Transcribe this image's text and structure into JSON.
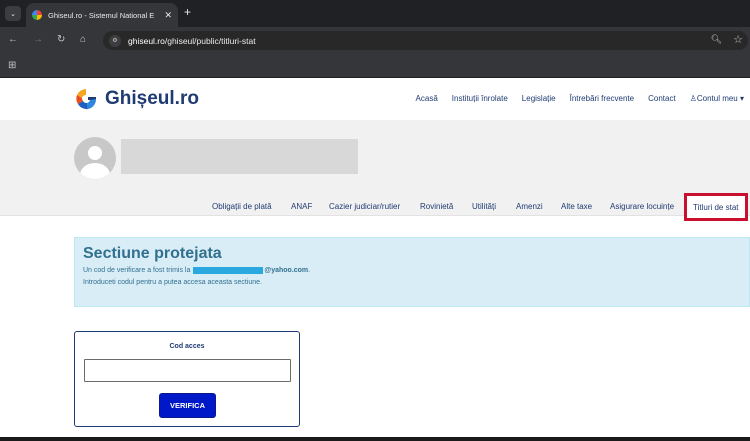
{
  "browser": {
    "tab_title": "Ghiseul.ro - Sistemul National E",
    "tab_close": "✕",
    "new_tab": "+",
    "tab_menu": "⌄",
    "url_domain": "ghiseul.ro",
    "url_path": "/ghiseul/public/titluri-stat",
    "icons": {
      "back": "←",
      "forward": "→",
      "reload": "↻",
      "home": "⌂",
      "zoom": "🔍︎",
      "star": "☆",
      "apps": "⊞",
      "site_info": "⚙"
    }
  },
  "header": {
    "logo_text": "Ghișeul.ro",
    "nav": [
      "Acasă",
      "Instituții înrolate",
      "Legislație",
      "Întrebări frecvente",
      "Contact",
      "♙Contul meu ▾"
    ]
  },
  "subnav": {
    "items": [
      "Obligații de plată",
      "ANAF",
      "Cazier judiciar/rutier",
      "Rovinietă",
      "Utilități",
      "Amenzi",
      "Alte taxe",
      "Asigurare locuințe"
    ],
    "active": "Titluri de stat",
    "active_outline_color": "#c8102e"
  },
  "alert": {
    "title": "Sectiune protejata",
    "line1_prefix": "Un cod de verificare a fost trimis la",
    "line1_email_suffix": "@yahoo.com",
    "line1_end": ".",
    "line2": "Introduceti codul pentru a putea accesa aceasta sectiune."
  },
  "form": {
    "label": "Cod acces",
    "input_value": "",
    "button_label": "VERIFICA"
  },
  "colors": {
    "brand_blue": "#1f3b73",
    "button_blue": "#0018c8",
    "alert_bg": "#d9edf7",
    "alert_text": "#31708f"
  }
}
